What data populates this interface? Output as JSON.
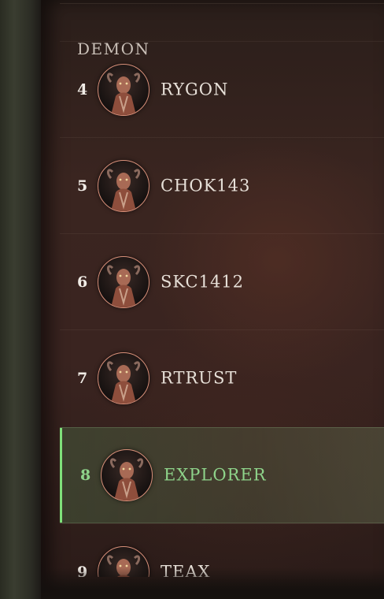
{
  "section": {
    "title": "DEMON"
  },
  "leaderboard": {
    "rows": [
      {
        "rank": "4",
        "name": "RYGON",
        "avatar_icon": "demon-portrait-icon",
        "highlighted": false
      },
      {
        "rank": "5",
        "name": "CHOK143",
        "avatar_icon": "demon-portrait-icon",
        "highlighted": false
      },
      {
        "rank": "6",
        "name": "SKC1412",
        "avatar_icon": "demon-portrait-icon",
        "highlighted": false
      },
      {
        "rank": "7",
        "name": "RTRUST",
        "avatar_icon": "demon-portrait-icon",
        "highlighted": false
      },
      {
        "rank": "8",
        "name": "EXPLORER",
        "avatar_icon": "demon-portrait-icon",
        "highlighted": true
      },
      {
        "rank": "9",
        "name": "TEAX",
        "avatar_icon": "demon-portrait-icon",
        "highlighted": false
      }
    ]
  },
  "colors": {
    "highlight_accent": "#7fe07a",
    "highlight_text": "#8ed38a",
    "avatar_border": "#d8907a",
    "text": "#e7e0d8"
  }
}
